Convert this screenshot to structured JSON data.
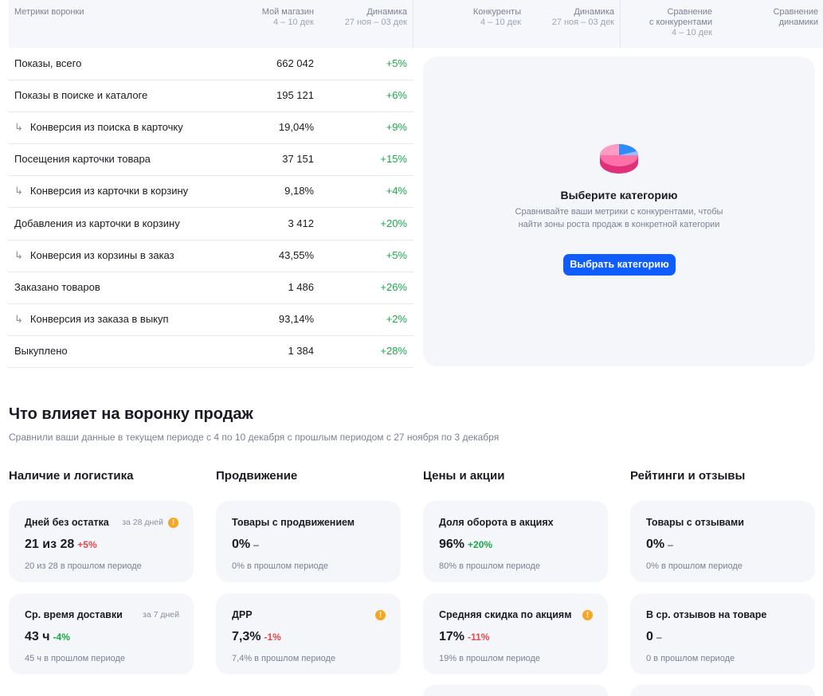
{
  "table": {
    "headers": {
      "metrics": "Метрики воронки",
      "my_store": "Мой магазин",
      "my_store_period": "4 – 10 дек",
      "dynamics": "Динамика",
      "dynamics_period": "27 ноя – 03 дек",
      "competitors": "Конкуренты",
      "competitors_period": "4 – 10 дек",
      "dynamics2": "Динамика",
      "dynamics2_period": "27 ноя – 03 дек",
      "comparison_line1": "Сравнение",
      "comparison_line2": "с конкурентами",
      "comparison_period": "4 – 10 дек",
      "comparison_dyn_line1": "Сравнение",
      "comparison_dyn_line2": "динамики"
    },
    "rows": [
      {
        "name": "Показы, всего",
        "value": "662 042",
        "dynamic": "+5%",
        "sub": false
      },
      {
        "name": "Показы в поиске и каталоге",
        "value": "195 121",
        "dynamic": "+6%",
        "sub": false
      },
      {
        "name": "Конверсия из поиска в карточку",
        "value": "19,04%",
        "dynamic": "+9%",
        "sub": true
      },
      {
        "name": "Посещения карточки товара",
        "value": "37 151",
        "dynamic": "+15%",
        "sub": false
      },
      {
        "name": "Конверсия из карточки в корзину",
        "value": "9,18%",
        "dynamic": "+4%",
        "sub": true
      },
      {
        "name": "Добавления из карточки в корзину",
        "value": "3 412",
        "dynamic": "+20%",
        "sub": false
      },
      {
        "name": "Конверсия из корзины в заказ",
        "value": "43,55%",
        "dynamic": "+5%",
        "sub": true
      },
      {
        "name": "Заказано товаров",
        "value": "1 486",
        "dynamic": "+26%",
        "sub": false
      },
      {
        "name": "Конверсия из заказа в выкуп",
        "value": "93,14%",
        "dynamic": "+2%",
        "sub": true
      },
      {
        "name": "Выкуплено",
        "value": "1 384",
        "dynamic": "+28%",
        "sub": false
      }
    ]
  },
  "category_card": {
    "icon": "pie-chart-icon",
    "title": "Выберите категорию",
    "description": "Сравнивайте ваши метрики с конкурентами, чтобы найти зоны роста продаж в конкретной категории",
    "button": "Выбрать категорию"
  },
  "funnel": {
    "title": "Что влияет на воронку продаж",
    "subtitle": "Сравнили ваши данные в текущем периоде с 4 по 10 декабря с прошлым периодом с 27 ноября по 3 декабря",
    "columns": [
      {
        "title": "Наличие и логистика",
        "cards": [
          {
            "title": "Дней без остатка",
            "period": "за 28 дней",
            "warn": true,
            "value": "21 из 28",
            "change": "+5%",
            "change_color": "red",
            "prev": "20 из 28 в прошлом периоде"
          },
          {
            "title": "Ср. время доставки",
            "period": "за 7 дней",
            "warn": false,
            "value": "43 ч",
            "change": "-4%",
            "change_color": "green",
            "prev": "45 ч в прошлом периоде"
          }
        ]
      },
      {
        "title": "Продвижение",
        "cards": [
          {
            "title": "Товары с продвижением",
            "period": "",
            "warn": false,
            "value": "0%",
            "change": "–",
            "change_color": "neutral",
            "prev": "0% в прошлом периоде"
          },
          {
            "title": "ДРР",
            "period": "",
            "warn": true,
            "value": "7,3%",
            "change": "-1%",
            "change_color": "red",
            "prev": "7,4% в прошлом периоде"
          }
        ]
      },
      {
        "title": "Цены и акции",
        "cards": [
          {
            "title": "Доля оборота в акциях",
            "period": "",
            "warn": false,
            "value": "96%",
            "change": "+20%",
            "change_color": "green",
            "prev": "80% в прошлом периоде"
          },
          {
            "title": "Средняя скидка по акциям",
            "period": "",
            "warn": true,
            "value": "17%",
            "change": "-11%",
            "change_color": "red",
            "prev": "19% в прошлом периоде"
          }
        ]
      },
      {
        "title": "Рейтинги и отзывы",
        "cards": [
          {
            "title": "Товары с отзывами",
            "period": "",
            "warn": false,
            "value": "0%",
            "change": "–",
            "change_color": "neutral",
            "prev": "0% в прошлом периоде"
          },
          {
            "title": "В ср. отзывов на товаре",
            "period": "",
            "warn": false,
            "value": "0",
            "change": "–",
            "change_color": "neutral",
            "prev": "0 в прошлом периоде"
          }
        ]
      }
    ]
  },
  "colors": {
    "accent": "#0f5cff",
    "positive": "#1aa94a",
    "negative": "#e5484d",
    "warning": "#f5a623"
  }
}
